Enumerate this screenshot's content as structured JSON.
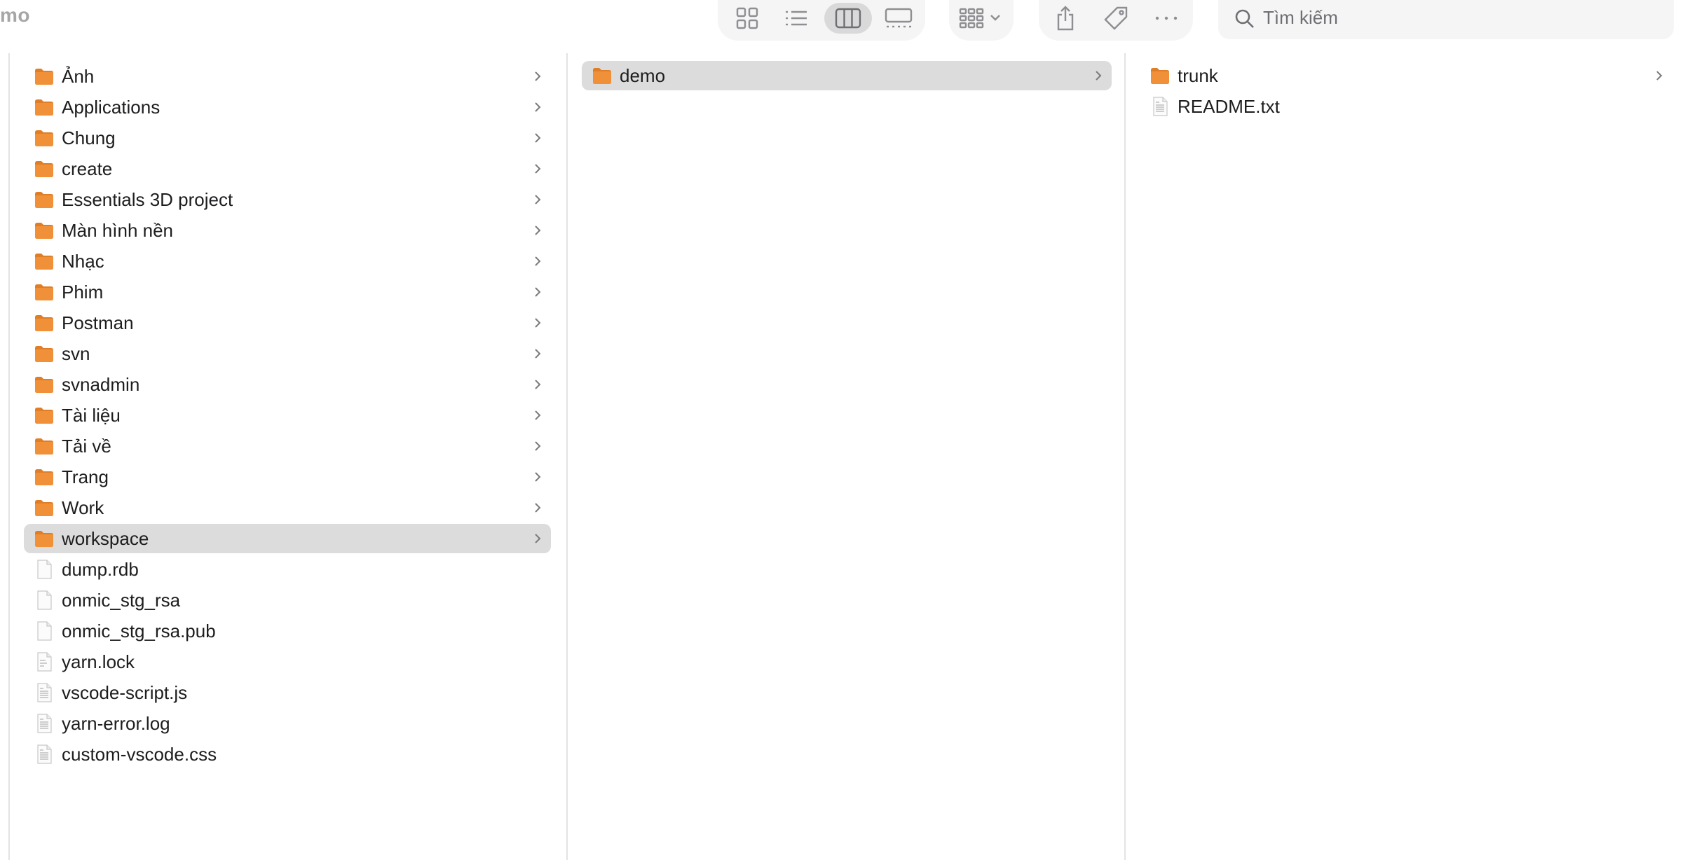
{
  "window": {
    "title": "mo"
  },
  "toolbar": {
    "view_icons": [
      "icon-view-icon",
      "list-view-icon",
      "column-view-icon",
      "gallery-view-icon"
    ],
    "group_icon": "group-by-icon",
    "action_icons": [
      "share-icon",
      "tag-icon",
      "more-icon"
    ],
    "search_placeholder": "Tìm kiếm"
  },
  "columns": [
    {
      "items": [
        {
          "name": "Ảnh",
          "kind": "folder",
          "has_children": true
        },
        {
          "name": "Applications",
          "kind": "folder",
          "has_children": true
        },
        {
          "name": "Chung",
          "kind": "folder",
          "has_children": true
        },
        {
          "name": "create",
          "kind": "folder",
          "has_children": true
        },
        {
          "name": "Essentials 3D project",
          "kind": "folder",
          "has_children": true
        },
        {
          "name": "Màn hình nền",
          "kind": "folder",
          "has_children": true
        },
        {
          "name": "Nhạc",
          "kind": "folder",
          "has_children": true
        },
        {
          "name": "Phim",
          "kind": "folder",
          "has_children": true
        },
        {
          "name": "Postman",
          "kind": "folder",
          "has_children": true
        },
        {
          "name": "svn",
          "kind": "folder",
          "has_children": true
        },
        {
          "name": "svnadmin",
          "kind": "folder",
          "has_children": true
        },
        {
          "name": "Tài liệu",
          "kind": "folder",
          "has_children": true
        },
        {
          "name": "Tải về",
          "kind": "folder",
          "has_children": true
        },
        {
          "name": "Trang",
          "kind": "folder",
          "has_children": true
        },
        {
          "name": "Work",
          "kind": "folder",
          "has_children": true
        },
        {
          "name": "workspace",
          "kind": "folder",
          "has_children": true,
          "selected": true
        },
        {
          "name": "dump.rdb",
          "kind": "file",
          "has_children": false
        },
        {
          "name": "onmic_stg_rsa",
          "kind": "file",
          "has_children": false
        },
        {
          "name": "onmic_stg_rsa.pub",
          "kind": "file",
          "has_children": false
        },
        {
          "name": "yarn.lock",
          "kind": "text",
          "has_children": false
        },
        {
          "name": "vscode-script.js",
          "kind": "doc",
          "has_children": false
        },
        {
          "name": "yarn-error.log",
          "kind": "doc",
          "has_children": false
        },
        {
          "name": "custom-vscode.css",
          "kind": "doc",
          "has_children": false
        }
      ]
    },
    {
      "items": [
        {
          "name": "demo",
          "kind": "folder",
          "has_children": true,
          "selected": true
        }
      ]
    },
    {
      "items": [
        {
          "name": "trunk",
          "kind": "folder",
          "has_children": true
        },
        {
          "name": "README.txt",
          "kind": "doc",
          "has_children": false
        }
      ]
    }
  ],
  "colors": {
    "folder": "#f0913a",
    "folder_tab": "#e07e27",
    "selection": "#dcdcdc"
  }
}
